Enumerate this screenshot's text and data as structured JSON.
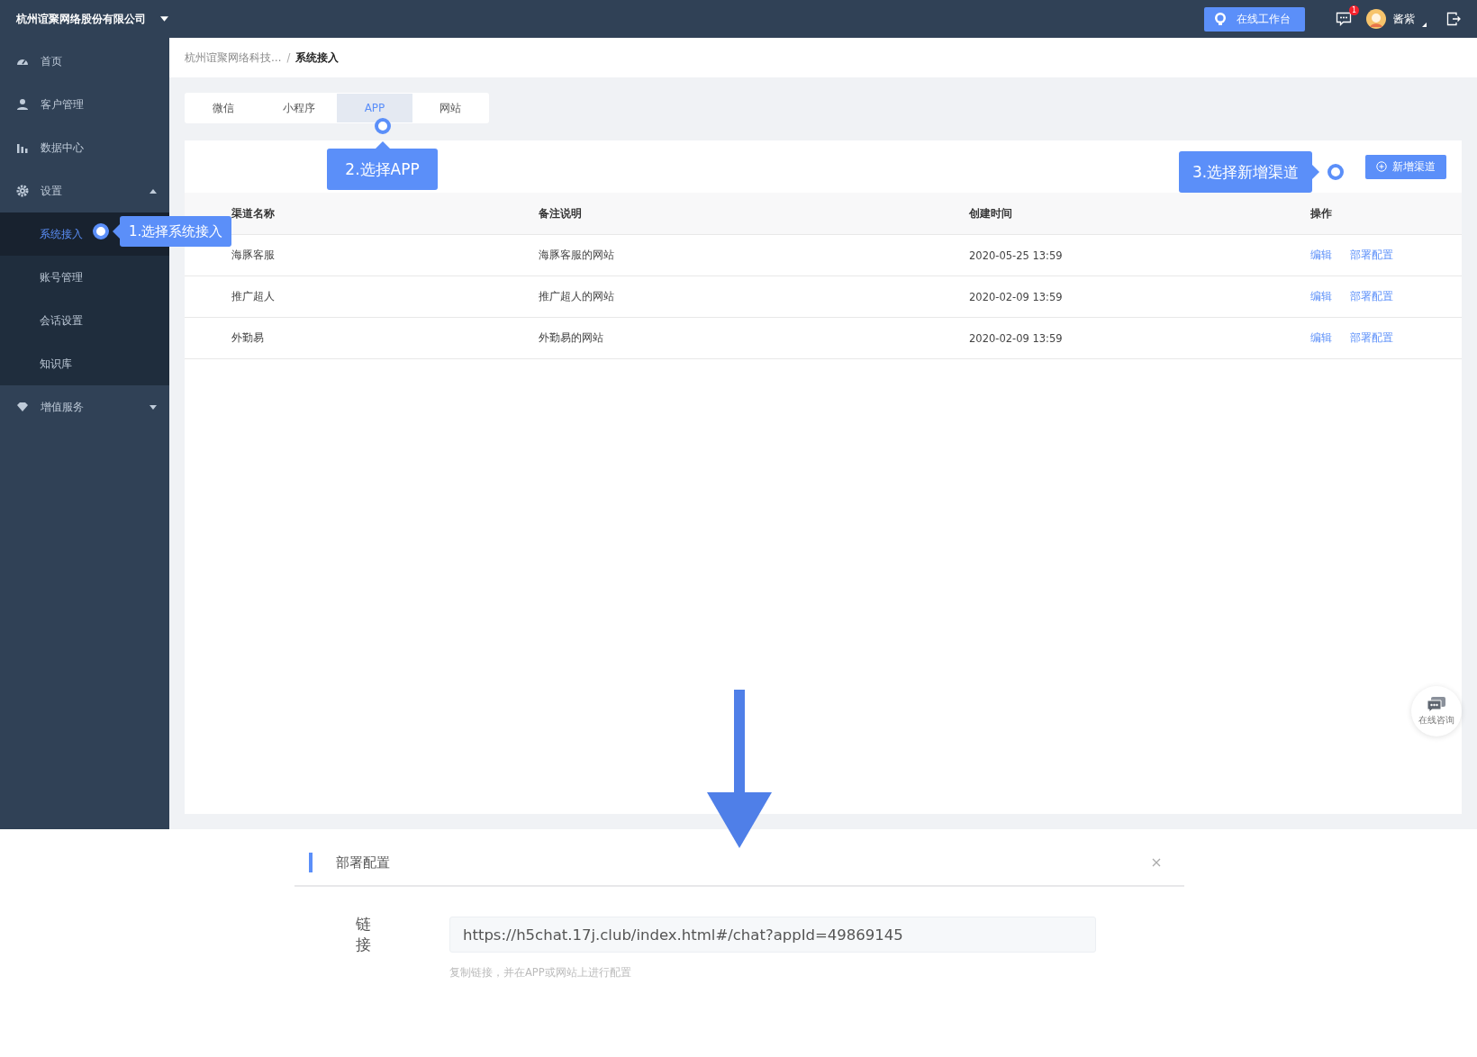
{
  "top_bar": {
    "company": "杭州谊聚网络股份有限公司",
    "workbench_button": "在线工作台",
    "message_badge": "1",
    "user_name": "酱紫"
  },
  "sidebar": {
    "items": [
      {
        "label": "首页"
      },
      {
        "label": "客户管理"
      },
      {
        "label": "数据中心"
      },
      {
        "label": "设置",
        "expanded": true,
        "children": [
          {
            "label": "系统接入",
            "selected": true
          },
          {
            "label": "账号管理",
            "selected": false
          },
          {
            "label": "会话设置",
            "selected": false
          },
          {
            "label": "知识库",
            "selected": false
          }
        ]
      },
      {
        "label": "增值服务",
        "expanded": false
      }
    ]
  },
  "breadcrumb": [
    "杭州谊聚网络科技…",
    "系统接入"
  ],
  "breadcrumb_separator": "/",
  "tabs": [
    {
      "label": "微信",
      "selected": false
    },
    {
      "label": "小程序",
      "selected": false
    },
    {
      "label": "APP",
      "selected": true
    },
    {
      "label": "网站",
      "selected": false
    }
  ],
  "add_button": "新增渠道",
  "table": {
    "columns": [
      "渠道名称",
      "备注说明",
      "创建时间",
      "操作"
    ],
    "rows": [
      {
        "name": "海豚客服",
        "note": "海豚客服的网站",
        "created": "2020-05-25 13:59",
        "actions": [
          "编辑",
          "部署配置"
        ]
      },
      {
        "name": "推广超人",
        "note": "推广超人的网站",
        "created": "2020-02-09 13:59",
        "actions": [
          "编辑",
          "部署配置"
        ]
      },
      {
        "name": "外勤易",
        "note": "外勤易的网站",
        "created": "2020-02-09 13:59",
        "actions": [
          "编辑",
          "部署配置"
        ]
      }
    ]
  },
  "callouts": [
    "1.选择系统接入",
    "2.选择APP",
    "3.选择新增渠道"
  ],
  "float_button": "在线咨询",
  "dialog": {
    "title": "部署配置",
    "field_label": "链接",
    "link_value": "https://h5chat.17j.club/index.html#/chat?appId=49869145",
    "hint": "复制链接，并在APP或网站上进行配置"
  }
}
